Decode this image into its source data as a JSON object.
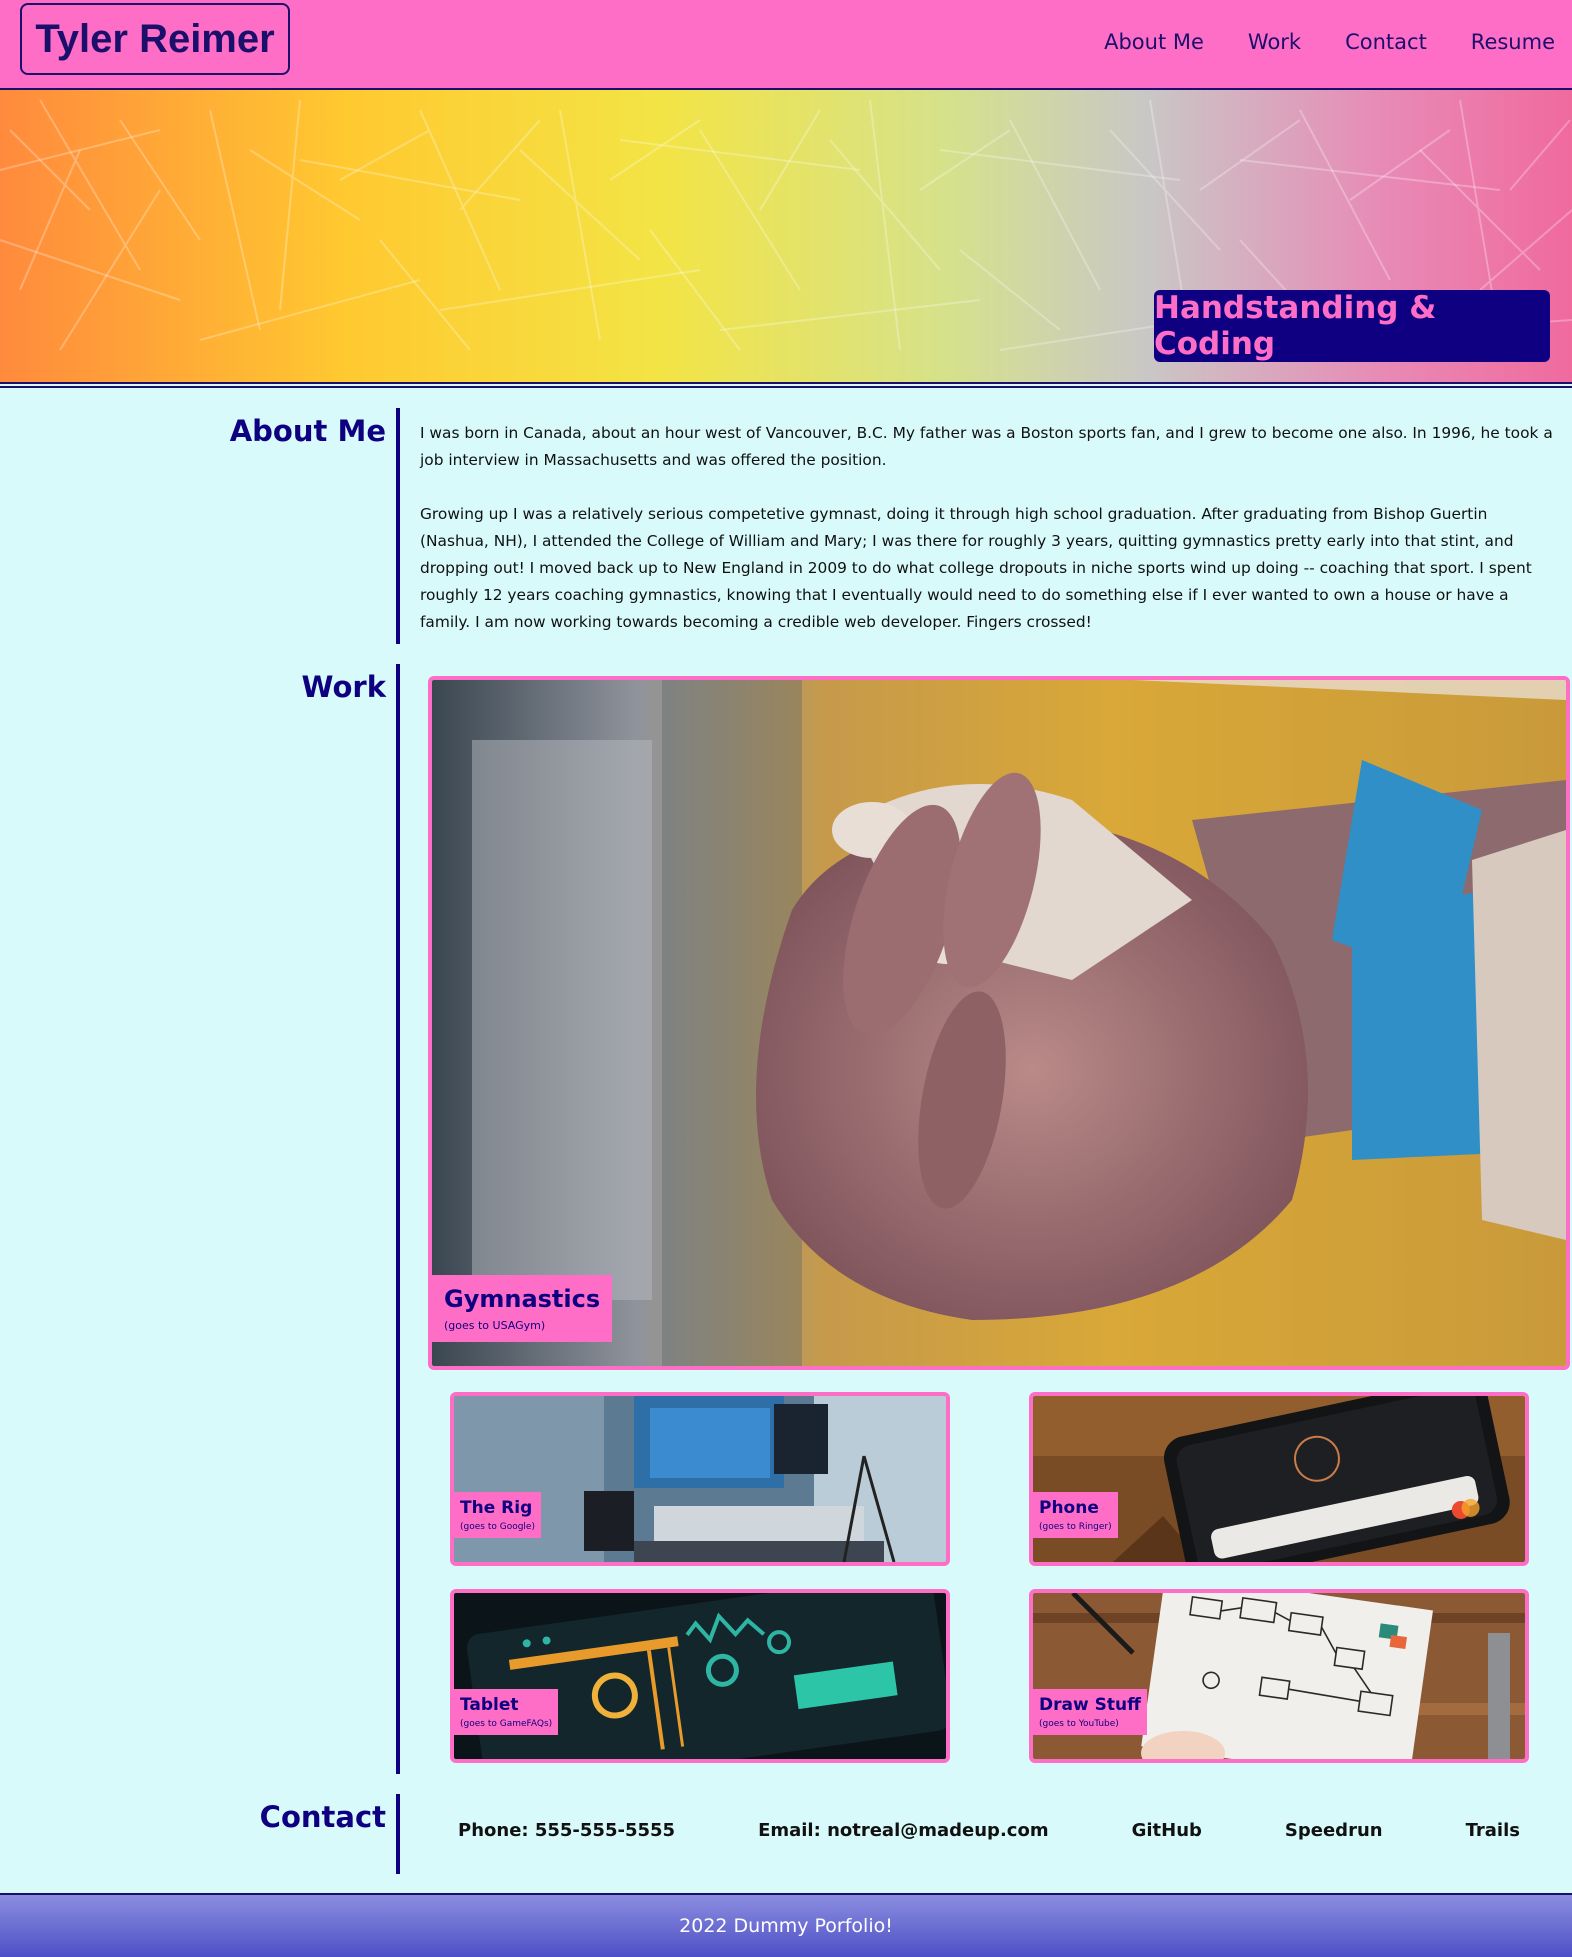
{
  "header": {
    "logo": "Tyler Reimer",
    "nav": [
      "About Me",
      "Work",
      "Contact",
      "Resume"
    ]
  },
  "hero": {
    "tagline": "Handstanding & Coding"
  },
  "about": {
    "title": "About Me",
    "paragraphs": [
      "I was born in Canada, about an hour west of Vancouver, B.C. My father was a Boston sports fan, and I grew to become one also. In 1996, he took a job interview in Massachusetts and was offered the position.",
      "Growing up I was a relatively serious competetive gymnast, doing it through high school graduation. After graduating from Bishop Guertin (Nashua, NH), I attended the College of William and Mary; I was there for roughly 3 years, quitting gymnastics pretty early into that stint, and dropping out! I moved back up to New England in 2009 to do what college dropouts in niche sports wind up doing -- coaching that sport. I spent roughly 12 years coaching gymnastics, knowing that I eventually would need to do something else if I ever wanted to own a house or have a family. I am now working towards becoming a credible web developer. Fingers crossed!"
    ]
  },
  "work": {
    "title": "Work",
    "featured": {
      "title": "Gymnastics",
      "subtitle": "(goes to USAGym)"
    },
    "items": [
      {
        "title": "The Rig",
        "subtitle": "(goes to Google)"
      },
      {
        "title": "Phone",
        "subtitle": "(goes to Ringer)"
      },
      {
        "title": "Tablet",
        "subtitle": "(goes to GameFAQs)"
      },
      {
        "title": "Draw Stuff",
        "subtitle": "(goes to YouTube)"
      }
    ]
  },
  "contact": {
    "title": "Contact",
    "items": [
      "Phone: 555-555-5555",
      "Email: notreal@madeup.com",
      "GitHub",
      "Speedrun",
      "Trails"
    ]
  },
  "footer": {
    "text": "2022 Dummy Porfolio!"
  },
  "colors": {
    "pink": "#ff6ec6",
    "navy": "#0e0080",
    "background": "#d8fafa"
  }
}
